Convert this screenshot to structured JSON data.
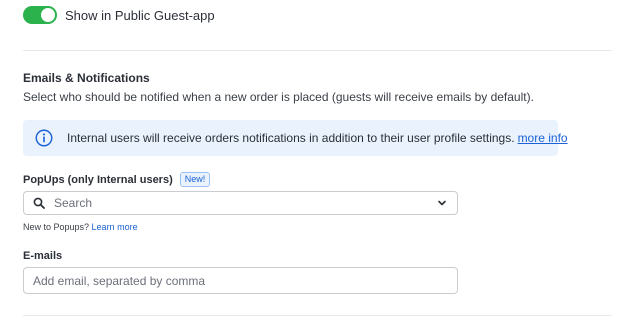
{
  "guest_app_toggle": {
    "label": "Show in Public Guest-app",
    "enabled": true
  },
  "notifications": {
    "title": "Emails & Notifications",
    "description": "Select who should be notified when a new order is placed (guests will receive emails by default)."
  },
  "info_banner": {
    "icon": "info-circle-icon",
    "text": "Internal users will receive orders notifications in addition to their user profile settings.",
    "link_label": "more info"
  },
  "popups": {
    "label": "PopUps (only Internal users)",
    "badge": "New!",
    "select_placeholder": "Search",
    "helper_text": "New to Popups?",
    "helper_link": "Learn more"
  },
  "emails": {
    "label": "E-mails",
    "value": "",
    "placeholder": "Add email, separated by comma"
  },
  "colors": {
    "toggle_on": "#2bb24c",
    "link": "#1a62d6",
    "info_bg": "#e9f2fd"
  }
}
